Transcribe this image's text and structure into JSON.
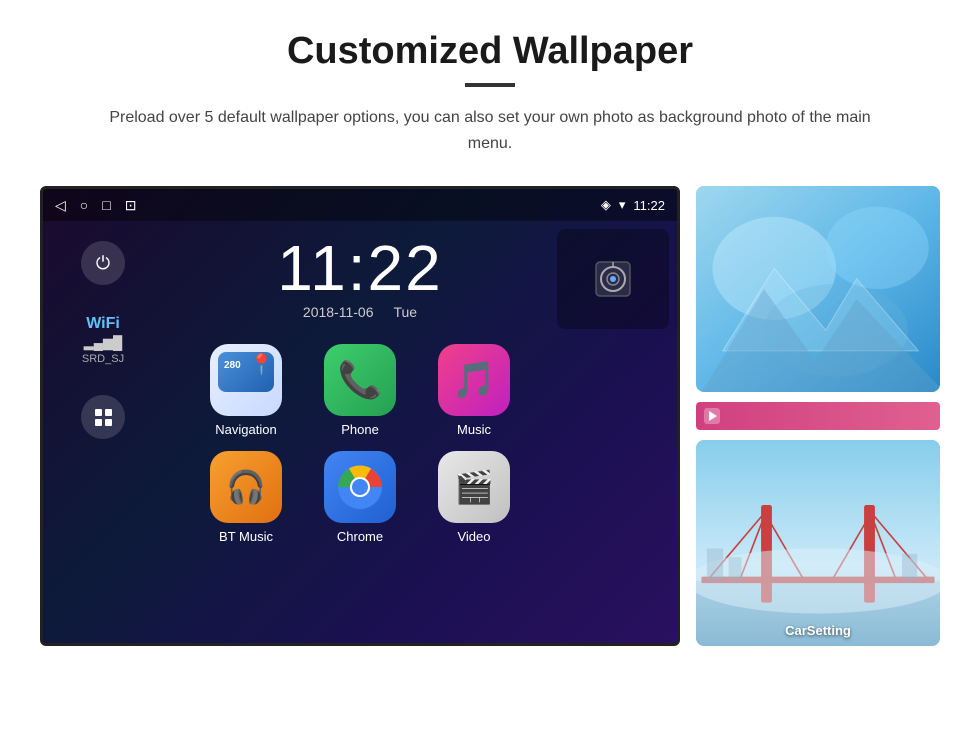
{
  "header": {
    "title": "Customized Wallpaper",
    "description": "Preload over 5 default wallpaper options, you can also set your own photo as background photo of the main menu."
  },
  "screen": {
    "time": "11:22",
    "date": "2018-11-06",
    "day": "Tue",
    "wifi_label": "WiFi",
    "wifi_network": "SRD_SJ",
    "status_time": "11:22"
  },
  "apps": [
    {
      "label": "Navigation",
      "id": "navigation"
    },
    {
      "label": "Phone",
      "id": "phone"
    },
    {
      "label": "Music",
      "id": "music"
    },
    {
      "label": "BT Music",
      "id": "bt-music"
    },
    {
      "label": "Chrome",
      "id": "chrome"
    },
    {
      "label": "Video",
      "id": "video"
    }
  ],
  "carsetting_label": "CarSetting"
}
